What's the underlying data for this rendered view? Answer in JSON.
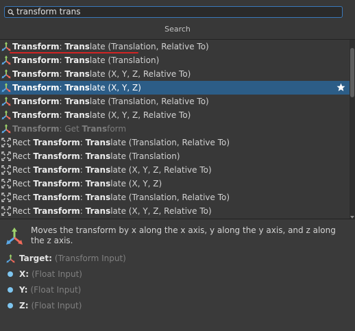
{
  "search": {
    "value": "transform trans"
  },
  "header": {
    "title": "Search"
  },
  "results": [
    {
      "icon": "transform-axes-icon",
      "prefix": "",
      "bold1": "Transform",
      "colon": ": ",
      "bold2": "Trans",
      "rest": "late (Translation, Relative To)",
      "selected": false,
      "dim": false
    },
    {
      "icon": "transform-axes-icon",
      "prefix": "",
      "bold1": "Transform",
      "colon": ": ",
      "bold2": "Trans",
      "rest": "late (Translation)",
      "selected": false,
      "dim": false
    },
    {
      "icon": "transform-axes-icon",
      "prefix": "",
      "bold1": "Transform",
      "colon": ": ",
      "bold2": "Trans",
      "rest": "late (X, Y, Z, Relative To)",
      "selected": false,
      "dim": false
    },
    {
      "icon": "transform-axes-icon",
      "prefix": "",
      "bold1": "Transform",
      "colon": ": ",
      "bold2": "Trans",
      "rest": "late (X, Y, Z)",
      "selected": true,
      "dim": false
    },
    {
      "icon": "transform-axes-icon",
      "prefix": "",
      "bold1": "Transform",
      "colon": ": ",
      "bold2": "Trans",
      "rest": "late (Translation, Relative To)",
      "selected": false,
      "dim": false
    },
    {
      "icon": "transform-axes-icon",
      "prefix": "",
      "bold1": "Transform",
      "colon": ": ",
      "bold2": "Trans",
      "rest": "late (X, Y, Z, Relative To)",
      "selected": false,
      "dim": false
    },
    {
      "icon": "transform-axes-icon",
      "prefix": "",
      "bold1": "Transform",
      "colon": ": Get ",
      "bold2": "Trans",
      "rest": "form",
      "selected": false,
      "dim": true
    },
    {
      "icon": "rect-transform-icon",
      "prefix": "Rect ",
      "bold1": "Transform",
      "colon": ": ",
      "bold2": "Trans",
      "rest": "late (Translation, Relative To)",
      "selected": false,
      "dim": false
    },
    {
      "icon": "rect-transform-icon",
      "prefix": "Rect ",
      "bold1": "Transform",
      "colon": ": ",
      "bold2": "Trans",
      "rest": "late (Translation)",
      "selected": false,
      "dim": false
    },
    {
      "icon": "rect-transform-icon",
      "prefix": "Rect ",
      "bold1": "Transform",
      "colon": ": ",
      "bold2": "Trans",
      "rest": "late (X, Y, Z, Relative To)",
      "selected": false,
      "dim": false
    },
    {
      "icon": "rect-transform-icon",
      "prefix": "Rect ",
      "bold1": "Transform",
      "colon": ": ",
      "bold2": "Trans",
      "rest": "late (X, Y, Z)",
      "selected": false,
      "dim": false
    },
    {
      "icon": "rect-transform-icon",
      "prefix": "Rect ",
      "bold1": "Transform",
      "colon": ": ",
      "bold2": "Trans",
      "rest": "late (Translation, Relative To)",
      "selected": false,
      "dim": false
    },
    {
      "icon": "rect-transform-icon",
      "prefix": "Rect ",
      "bold1": "Transform",
      "colon": ": ",
      "bold2": "Trans",
      "rest": "late (X, Y, Z, Relative To)",
      "selected": false,
      "dim": false
    }
  ],
  "details": {
    "description": "Moves the transform by x along the x axis, y along the y axis, and z along the z axis.",
    "params": [
      {
        "icon": "transform-axes-icon",
        "name": "Target:",
        "type": "(Transform Input)"
      },
      {
        "icon": "float-dot-icon",
        "name": "X:",
        "type": "(Float Input)"
      },
      {
        "icon": "float-dot-icon",
        "name": "Y:",
        "type": "(Float Input)"
      },
      {
        "icon": "float-dot-icon",
        "name": "Z:",
        "type": "(Float Input)"
      }
    ]
  },
  "colors": {
    "selection": "#2c5d87",
    "underline": "#d22424",
    "search_border": "#3a79bb",
    "float_port": "#7ec5ef"
  }
}
